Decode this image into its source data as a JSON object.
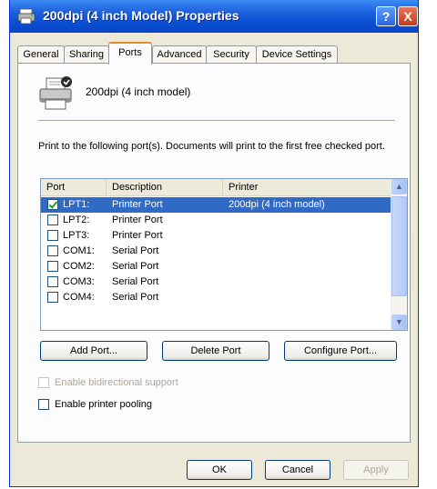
{
  "window": {
    "title": "200dpi (4 inch Model) Properties",
    "help_label": "?",
    "close_label": "X"
  },
  "tabs": [
    {
      "label": "General"
    },
    {
      "label": "Sharing"
    },
    {
      "label": "Ports"
    },
    {
      "label": "Advanced"
    },
    {
      "label": "Security"
    },
    {
      "label": "Device Settings"
    }
  ],
  "active_tab": "Ports",
  "printer": {
    "name": "200dpi (4 inch model)",
    "icon": "printer-icon"
  },
  "instruction": "Print to the following port(s). Documents will print to the first free checked port.",
  "port_list": {
    "columns": [
      "Port",
      "Description",
      "Printer"
    ],
    "rows": [
      {
        "port": "LPT1:",
        "description": "Printer Port",
        "printer": "200dpi (4 inch model)",
        "checked": true,
        "selected": true
      },
      {
        "port": "LPT2:",
        "description": "Printer Port",
        "printer": "",
        "checked": false,
        "selected": false
      },
      {
        "port": "LPT3:",
        "description": "Printer Port",
        "printer": "",
        "checked": false,
        "selected": false
      },
      {
        "port": "COM1:",
        "description": "Serial Port",
        "printer": "",
        "checked": false,
        "selected": false
      },
      {
        "port": "COM2:",
        "description": "Serial Port",
        "printer": "",
        "checked": false,
        "selected": false
      },
      {
        "port": "COM3:",
        "description": "Serial Port",
        "printer": "",
        "checked": false,
        "selected": false
      },
      {
        "port": "COM4:",
        "description": "Serial Port",
        "printer": "",
        "checked": false,
        "selected": false
      }
    ]
  },
  "port_buttons": {
    "add": "Add Port...",
    "delete": "Delete Port",
    "configure": "Configure Port..."
  },
  "options": {
    "bidirectional": {
      "label": "Enable bidirectional support",
      "checked": false,
      "enabled": false
    },
    "pooling": {
      "label": "Enable printer pooling",
      "checked": false,
      "enabled": true
    }
  },
  "dialog_buttons": {
    "ok": "OK",
    "cancel": "Cancel",
    "apply": "Apply"
  },
  "colors": {
    "titlebar": "#0a4fd3",
    "selection": "#316ac5",
    "active_tab_accent": "#e68b2c"
  }
}
